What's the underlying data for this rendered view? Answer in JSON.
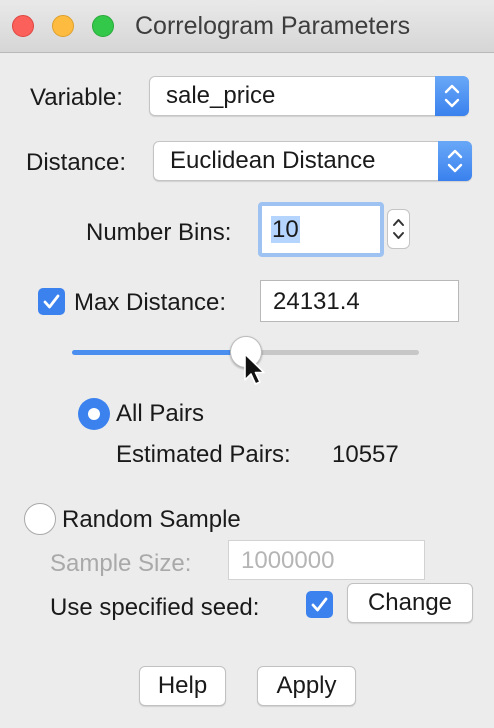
{
  "window": {
    "title": "Correlogram Parameters"
  },
  "variable": {
    "label": "Variable:",
    "value": "sale_price"
  },
  "distance": {
    "label": "Distance:",
    "value": "Euclidean Distance"
  },
  "bins": {
    "label": "Number Bins:",
    "value": "10"
  },
  "max_distance": {
    "label": "Max Distance:",
    "value": "24131.4",
    "checked": true,
    "slider_fraction": 0.5
  },
  "all_pairs": {
    "label": "All Pairs",
    "selected": true,
    "estimated_label": "Estimated Pairs:",
    "estimated_value": "10557"
  },
  "random_sample": {
    "label": "Random Sample",
    "selected": false,
    "size_label": "Sample Size:",
    "size_value": "1000000"
  },
  "seed": {
    "label": "Use specified seed:",
    "checked": true,
    "change_label": "Change"
  },
  "buttons": {
    "help": "Help",
    "apply": "Apply"
  },
  "colors": {
    "accent": "#3b82ef",
    "window_bg": "#ececec",
    "focus_ring": "#9ec3f2",
    "disabled_text": "#a9a9a9"
  },
  "icons": [
    "close-icon",
    "minimize-icon",
    "zoom-icon",
    "updown-chevron-icon",
    "checkmark-icon",
    "pointer-cursor-icon"
  ]
}
